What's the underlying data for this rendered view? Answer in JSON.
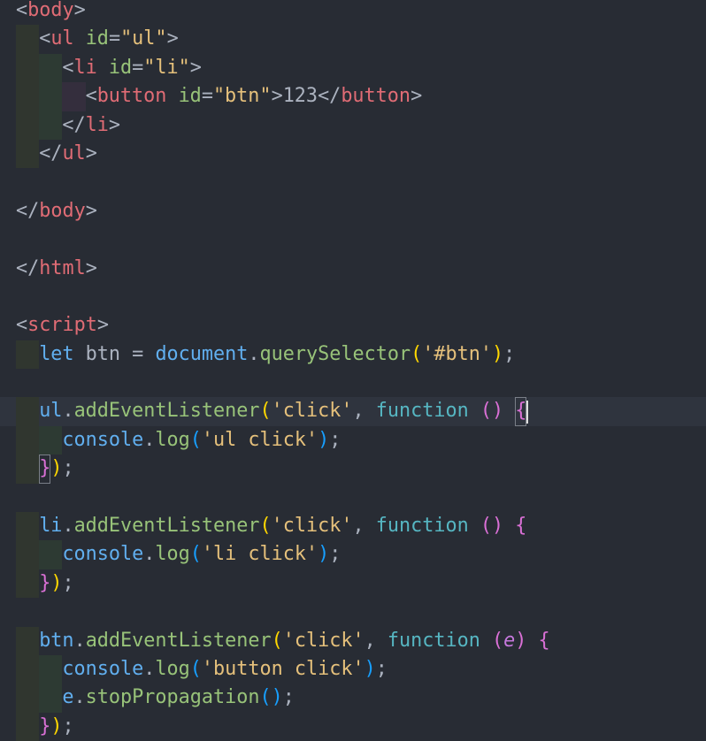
{
  "editor": {
    "theme_colors": {
      "background": "#282c34",
      "tag": "#e06c75",
      "attribute": "#98c379",
      "string": "#e5c07b",
      "keyword": "#61afef",
      "function_keyword": "#56b6c2"
    },
    "lines": [
      {
        "indent": 0,
        "tokens": [
          [
            "<",
            "p"
          ],
          [
            "body",
            "tag"
          ],
          [
            ">",
            "p"
          ]
        ]
      },
      {
        "indent": 1,
        "tokens": [
          [
            "<",
            "p"
          ],
          [
            "ul",
            "tag"
          ],
          [
            " ",
            "p"
          ],
          [
            "id",
            "attr"
          ],
          [
            "=",
            "p"
          ],
          [
            "\"ul\"",
            "str"
          ],
          [
            ">",
            "p"
          ]
        ]
      },
      {
        "indent": 2,
        "tokens": [
          [
            "<",
            "p"
          ],
          [
            "li",
            "tag"
          ],
          [
            " ",
            "p"
          ],
          [
            "id",
            "attr"
          ],
          [
            "=",
            "p"
          ],
          [
            "\"li\"",
            "str"
          ],
          [
            ">",
            "p"
          ]
        ]
      },
      {
        "indent": 3,
        "tokens": [
          [
            "<",
            "p"
          ],
          [
            "button",
            "tag"
          ],
          [
            " ",
            "p"
          ],
          [
            "id",
            "attr"
          ],
          [
            "=",
            "p"
          ],
          [
            "\"btn\"",
            "str"
          ],
          [
            ">",
            "p"
          ],
          [
            "123",
            "txt"
          ],
          [
            "</",
            "p"
          ],
          [
            "button",
            "tag"
          ],
          [
            ">",
            "p"
          ]
        ]
      },
      {
        "indent": 2,
        "tokens": [
          [
            "</",
            "p"
          ],
          [
            "li",
            "tag"
          ],
          [
            ">",
            "p"
          ]
        ]
      },
      {
        "indent": 1,
        "tokens": [
          [
            "</",
            "p"
          ],
          [
            "ul",
            "tag"
          ],
          [
            ">",
            "p"
          ]
        ]
      },
      {
        "indent": 0,
        "tokens": []
      },
      {
        "indent": 0,
        "tokens": [
          [
            "</",
            "p"
          ],
          [
            "body",
            "tag"
          ],
          [
            ">",
            "p"
          ]
        ]
      },
      {
        "indent": 0,
        "tokens": []
      },
      {
        "indent": 0,
        "tokens": [
          [
            "</",
            "p"
          ],
          [
            "html",
            "tag"
          ],
          [
            ">",
            "p"
          ]
        ]
      },
      {
        "indent": 0,
        "tokens": []
      },
      {
        "indent": 0,
        "tokens": [
          [
            "<",
            "p"
          ],
          [
            "script",
            "tag"
          ],
          [
            ">",
            "p"
          ]
        ]
      },
      {
        "indent": 1,
        "tokens": [
          [
            "let",
            "kw"
          ],
          [
            " btn = ",
            "p"
          ],
          [
            "document",
            "var"
          ],
          [
            ".",
            "p"
          ],
          [
            "querySelector",
            "meth"
          ],
          [
            "(",
            "b1"
          ],
          [
            "'#btn'",
            "str"
          ],
          [
            ")",
            "b1"
          ],
          [
            ";",
            "p"
          ]
        ]
      },
      {
        "indent": 0,
        "tokens": []
      },
      {
        "indent": 1,
        "current": true,
        "tokens": [
          [
            "ul",
            "var"
          ],
          [
            ".",
            "p"
          ],
          [
            "addEventListener",
            "meth"
          ],
          [
            "(",
            "b1"
          ],
          [
            "'click'",
            "str"
          ],
          [
            ", ",
            "p"
          ],
          [
            "function",
            "fn"
          ],
          [
            " ",
            "p"
          ],
          [
            "()",
            "b2"
          ],
          [
            " ",
            "p"
          ],
          [
            "{",
            "b2 box"
          ],
          [
            "|",
            "cursor"
          ]
        ]
      },
      {
        "indent": 2,
        "tokens": [
          [
            "console",
            "var"
          ],
          [
            ".",
            "p"
          ],
          [
            "log",
            "meth"
          ],
          [
            "(",
            "b3"
          ],
          [
            "'ul click'",
            "str"
          ],
          [
            ")",
            "b3"
          ],
          [
            ";",
            "p"
          ]
        ]
      },
      {
        "indent": 1,
        "tokens": [
          [
            "}",
            "b2 box"
          ],
          [
            ")",
            "b1"
          ],
          [
            ";",
            "p"
          ]
        ]
      },
      {
        "indent": 0,
        "tokens": []
      },
      {
        "indent": 1,
        "tokens": [
          [
            "li",
            "var"
          ],
          [
            ".",
            "p"
          ],
          [
            "addEventListener",
            "meth"
          ],
          [
            "(",
            "b1"
          ],
          [
            "'click'",
            "str"
          ],
          [
            ", ",
            "p"
          ],
          [
            "function",
            "fn"
          ],
          [
            " ",
            "p"
          ],
          [
            "()",
            "b2"
          ],
          [
            " ",
            "p"
          ],
          [
            "{",
            "b2"
          ]
        ]
      },
      {
        "indent": 2,
        "tokens": [
          [
            "console",
            "var"
          ],
          [
            ".",
            "p"
          ],
          [
            "log",
            "meth"
          ],
          [
            "(",
            "b3"
          ],
          [
            "'li click'",
            "str"
          ],
          [
            ")",
            "b3"
          ],
          [
            ";",
            "p"
          ]
        ]
      },
      {
        "indent": 1,
        "tokens": [
          [
            "}",
            "b2"
          ],
          [
            ")",
            "b1"
          ],
          [
            ";",
            "p"
          ]
        ]
      },
      {
        "indent": 0,
        "tokens": []
      },
      {
        "indent": 1,
        "tokens": [
          [
            "btn",
            "var"
          ],
          [
            ".",
            "p"
          ],
          [
            "addEventListener",
            "meth"
          ],
          [
            "(",
            "b1"
          ],
          [
            "'click'",
            "str"
          ],
          [
            ", ",
            "p"
          ],
          [
            "function",
            "fn"
          ],
          [
            " ",
            "p"
          ],
          [
            "(",
            "b2"
          ],
          [
            "e",
            "param"
          ],
          [
            ")",
            "b2"
          ],
          [
            " ",
            "p"
          ],
          [
            "{",
            "b2"
          ]
        ]
      },
      {
        "indent": 2,
        "tokens": [
          [
            "console",
            "var"
          ],
          [
            ".",
            "p"
          ],
          [
            "log",
            "meth"
          ],
          [
            "(",
            "b3"
          ],
          [
            "'button click'",
            "str"
          ],
          [
            ")",
            "b3"
          ],
          [
            ";",
            "p"
          ]
        ]
      },
      {
        "indent": 2,
        "tokens": [
          [
            "e",
            "var"
          ],
          [
            ".",
            "p"
          ],
          [
            "stopPropagation",
            "meth"
          ],
          [
            "()",
            "b3"
          ],
          [
            ";",
            "p"
          ]
        ]
      },
      {
        "indent": 1,
        "tokens": [
          [
            "}",
            "b2"
          ],
          [
            ")",
            "b1"
          ],
          [
            ";",
            "p"
          ]
        ]
      }
    ]
  }
}
